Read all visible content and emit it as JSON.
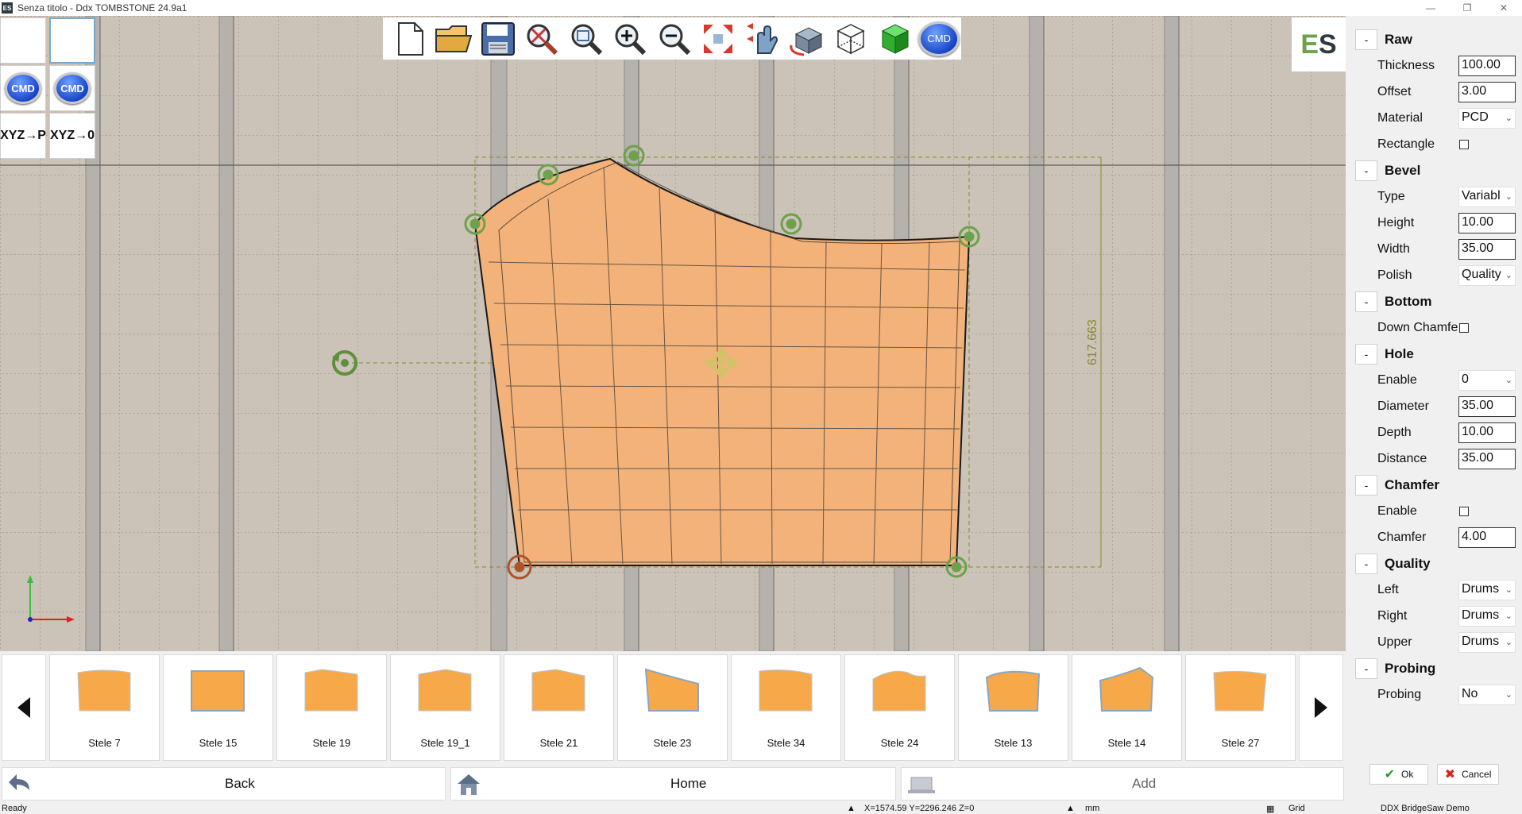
{
  "window": {
    "title": "Senza titolo - Ddx TOMBSTONE 24.9a1",
    "app_icon_text": "ES",
    "controls": [
      "minimize",
      "maximize",
      "close"
    ]
  },
  "left_tools": [
    {
      "name": "blank-tool-1",
      "label": ""
    },
    {
      "name": "blank-tool-2",
      "label": ""
    },
    {
      "name": "cmd-button-1",
      "label": "CMD"
    },
    {
      "name": "cmd-button-2",
      "label": "CMD"
    },
    {
      "name": "xyz-to-p-button",
      "label": "XYZ→P"
    },
    {
      "name": "xyz-to-zero-button",
      "label": "XYZ→0"
    }
  ],
  "toolbar": {
    "icons": [
      "new-file-icon",
      "open-folder-icon",
      "save-icon",
      "zoom-reset-icon",
      "zoom-window-icon",
      "zoom-in-icon",
      "zoom-out-icon",
      "zoom-extents-icon",
      "pan-hand-icon",
      "rotate-view-icon",
      "wireframe-cube-icon",
      "solid-cube-icon",
      "cmd-icon"
    ],
    "cmd_label": "CMD"
  },
  "logo": {
    "e": "E",
    "s": "S"
  },
  "canvas": {
    "dimension_label": "617.663",
    "shape_fill": "#f2b27a"
  },
  "panel": {
    "sections": [
      {
        "key": "raw",
        "title": "Raw",
        "collapse": "-"
      },
      {
        "key": "bevel",
        "title": "Bevel",
        "collapse": "-"
      },
      {
        "key": "bottom",
        "title": "Bottom",
        "collapse": "-"
      },
      {
        "key": "hole",
        "title": "Hole",
        "collapse": "-"
      },
      {
        "key": "chamfer",
        "title": "Chamfer",
        "collapse": "-"
      },
      {
        "key": "quality",
        "title": "Quality",
        "collapse": "-"
      },
      {
        "key": "probing",
        "title": "Probing",
        "collapse": "-"
      }
    ],
    "raw": {
      "thickness_label": "Thickness",
      "thickness": "100.00",
      "offset_label": "Offset",
      "offset": "3.00",
      "material_label": "Material",
      "material": "PCD",
      "rectangle_label": "Rectangle"
    },
    "bevel": {
      "type_label": "Type",
      "type": "Variabl",
      "height_label": "Height",
      "height": "10.00",
      "width_label": "Width",
      "width": "35.00",
      "polish_label": "Polish",
      "polish": "Quality"
    },
    "bottom": {
      "down_chamfer_label": "Down Chamfe"
    },
    "hole": {
      "enable_label": "Enable",
      "enable": "0",
      "diameter_label": "Diameter",
      "diameter": "35.00",
      "depth_label": "Depth",
      "depth": "10.00",
      "distance_label": "Distance",
      "distance": "35.00"
    },
    "chamfer": {
      "enable_label": "Enable",
      "chamfer_label": "Chamfer",
      "chamfer": "4.00"
    },
    "quality": {
      "left_label": "Left",
      "left": "Drums",
      "right_label": "Right",
      "right": "Drums",
      "upper_label": "Upper",
      "upper": "Drums"
    },
    "probing": {
      "probing_label": "Probing",
      "probing": "No"
    },
    "ok_label": "Ok",
    "cancel_label": "Cancel"
  },
  "gallery": {
    "items": [
      {
        "label": "Stele 7"
      },
      {
        "label": "Stele 15"
      },
      {
        "label": "Stele 19"
      },
      {
        "label": "Stele 19_1"
      },
      {
        "label": "Stele 21"
      },
      {
        "label": "Stele 23"
      },
      {
        "label": "Stele 34"
      },
      {
        "label": "Stele 24"
      },
      {
        "label": "Stele 13"
      },
      {
        "label": "Stele 14"
      },
      {
        "label": "Stele 27"
      }
    ]
  },
  "bottom_nav": {
    "back_label": "Back",
    "home_label": "Home",
    "add_label": "Add"
  },
  "status": {
    "ready": "Ready",
    "coords": "X=1574.59  Y=2296.246  Z=0",
    "units": "mm",
    "grid": "Grid",
    "product": "DDX BridgeSaw Demo"
  },
  "colors": {
    "accent_blue": "#1846c8",
    "handle_green": "#6ca24a",
    "stone_fill": "#f2b27a",
    "origin_handle": "#b0532a"
  }
}
